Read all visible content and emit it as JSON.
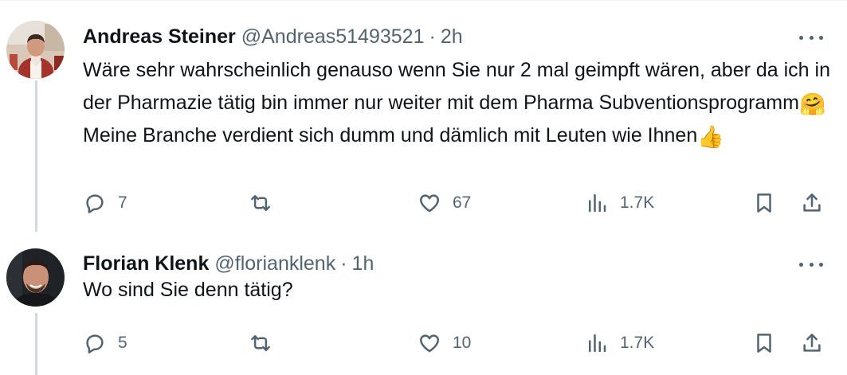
{
  "tweets": [
    {
      "name": "Andreas Steiner",
      "handle": "@Andreas51493521",
      "separator": "·",
      "time": "2h",
      "text_parts": [
        "Wäre sehr wahrscheinlich genauso wenn Sie nur 2 mal geimpft wären, aber da ich in der Pharmazie tätig bin immer nur weiter mit dem Pharma Subventionsprogramm",
        "🤗",
        "Meine Branche verdient sich dumm und dämlich mit Leuten wie Ihnen",
        "👍"
      ],
      "replies": "7",
      "retweets": "",
      "likes": "67",
      "views": "1.7K"
    },
    {
      "name": "Florian Klenk",
      "handle": "@florianklenk",
      "separator": "·",
      "time": "1h",
      "text": "Wo sind Sie denn tätig?",
      "replies": "5",
      "retweets": "",
      "likes": "10",
      "views": "1.7K"
    }
  ],
  "icons": {
    "more": "more-dots-icon",
    "reply": "reply-bubble-icon",
    "retweet": "retweet-icon",
    "like": "heart-icon",
    "views": "views-chart-icon",
    "bookmark": "bookmark-icon",
    "share": "share-icon"
  },
  "colors": {
    "text": "#0f1419",
    "secondary": "#536471",
    "thread_line": "#cfd9de",
    "background": "#ffffff"
  }
}
